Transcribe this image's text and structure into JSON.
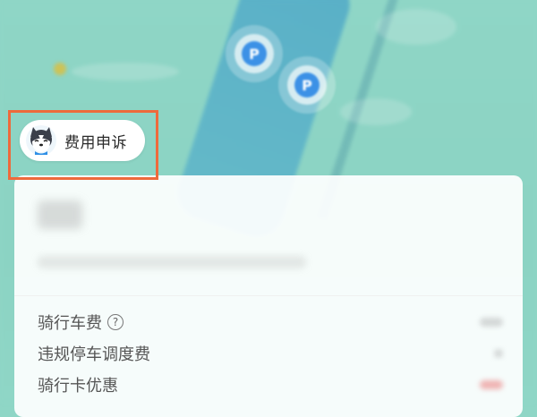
{
  "appeal_button": {
    "label": "费用申诉",
    "avatar_icon": "husky-avatar-icon"
  },
  "map": {
    "pin_icon": "parking-pin-icon",
    "pin_label": "P"
  },
  "fees": [
    {
      "label": "骑行车费",
      "has_help": true,
      "help_glyph": "?"
    },
    {
      "label": "违规停车调度费",
      "has_help": false
    },
    {
      "label": "骑行卡优惠",
      "has_help": false
    }
  ],
  "colors": {
    "map_bg": "#8fd6c6",
    "pin_blue": "#3c91e6",
    "highlight_border": "#ee6a3c",
    "discount_red": "#e65a5a"
  }
}
